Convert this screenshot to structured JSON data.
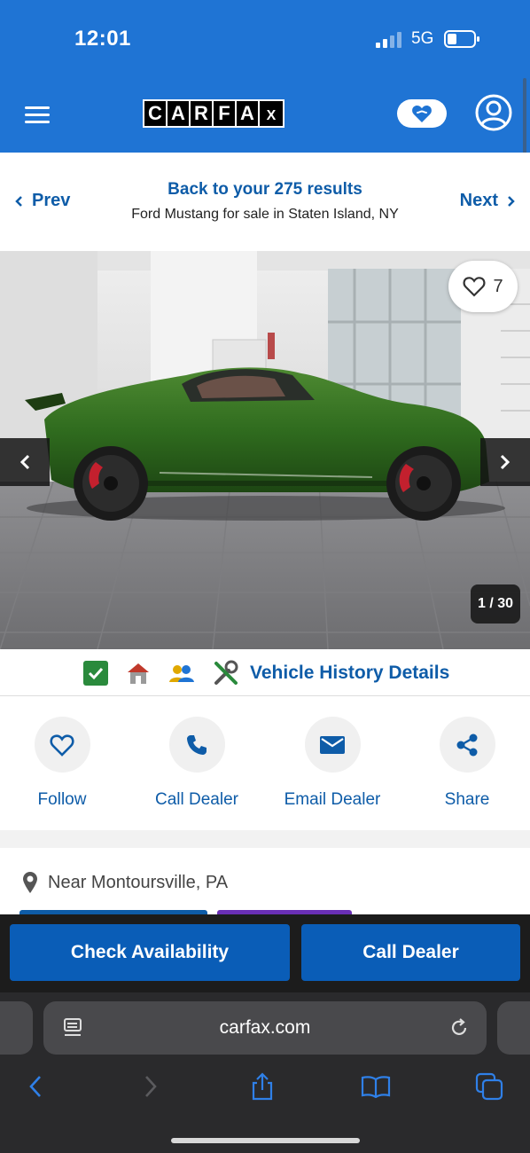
{
  "status_bar": {
    "time": "12:01",
    "network": "5G"
  },
  "header": {
    "logo_letters": [
      "C",
      "A",
      "R",
      "F",
      "A",
      "X"
    ],
    "icons": {
      "menu": "hamburger-icon",
      "favorites": "heart-icon",
      "account": "user-icon"
    }
  },
  "results_nav": {
    "prev_label": "Prev",
    "next_label": "Next",
    "back_label": "Back to your 275 results",
    "subtitle": "Ford Mustang for sale in Staten Island, NY"
  },
  "photo": {
    "save_count": "7",
    "counter": "1 / 30",
    "car_color": "#2f6b1e",
    "caliper_color": "#c3202e"
  },
  "history": {
    "link_label": "Vehicle History Details",
    "icons": [
      "clean-title-check-icon",
      "house-icon",
      "owners-icon",
      "tools-icon"
    ]
  },
  "actions": [
    {
      "label": "Follow",
      "icon": "heart-icon"
    },
    {
      "label": "Call Dealer",
      "icon": "phone-icon"
    },
    {
      "label": "Email Dealer",
      "icon": "mail-icon"
    },
    {
      "label": "Share",
      "icon": "share-icon"
    }
  ],
  "location": {
    "text": "Near Montoursville, PA"
  },
  "cta": {
    "check_availability": "Check Availability",
    "call_dealer": "Call Dealer"
  },
  "browser": {
    "url": "carfax.com"
  },
  "colors": {
    "brand_blue": "#1f74d4",
    "link_blue": "#0e5ca8",
    "cta_blue": "#0a5db7"
  }
}
